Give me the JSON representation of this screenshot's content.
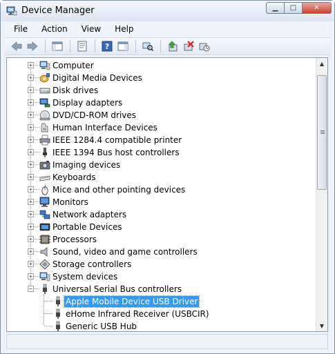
{
  "window": {
    "title": "Device Manager"
  },
  "menu": {
    "file": "File",
    "action": "Action",
    "view": "View",
    "help": "Help"
  },
  "tree": {
    "categories": [
      {
        "label": "Computer",
        "icon": "computer-icon"
      },
      {
        "label": "Digital Media Devices",
        "icon": "digital-media-icon"
      },
      {
        "label": "Disk drives",
        "icon": "disk-drive-icon"
      },
      {
        "label": "Display adapters",
        "icon": "display-adapter-icon"
      },
      {
        "label": "DVD/CD-ROM drives",
        "icon": "dvd-drive-icon"
      },
      {
        "label": "Human Interface Devices",
        "icon": "hid-icon"
      },
      {
        "label": "IEEE 1284.4 compatible printer",
        "icon": "printer-icon"
      },
      {
        "label": "IEEE 1394 Bus host controllers",
        "icon": "firewire-icon"
      },
      {
        "label": "Imaging devices",
        "icon": "camera-icon"
      },
      {
        "label": "Keyboards",
        "icon": "keyboard-icon"
      },
      {
        "label": "Mice and other pointing devices",
        "icon": "mouse-icon"
      },
      {
        "label": "Monitors",
        "icon": "monitor-icon"
      },
      {
        "label": "Network adapters",
        "icon": "network-adapter-icon"
      },
      {
        "label": "Portable Devices",
        "icon": "portable-device-icon"
      },
      {
        "label": "Processors",
        "icon": "processor-icon"
      },
      {
        "label": "Sound, video and game controllers",
        "icon": "speaker-icon"
      },
      {
        "label": "Storage controllers",
        "icon": "storage-controller-icon"
      },
      {
        "label": "System devices",
        "icon": "system-device-icon"
      },
      {
        "label": "Universal Serial Bus controllers",
        "icon": "usb-icon"
      }
    ],
    "usb_children": [
      {
        "label": "Apple Mobile Device USB Driver",
        "selected": true
      },
      {
        "label": "eHome Infrared Receiver (USBCIR)",
        "selected": false
      },
      {
        "label": "Generic USB Hub",
        "selected": false
      }
    ]
  },
  "colors": {
    "selection": "#3399ff",
    "window_bg": "#eef3fa",
    "close_button": "#c7452f"
  }
}
